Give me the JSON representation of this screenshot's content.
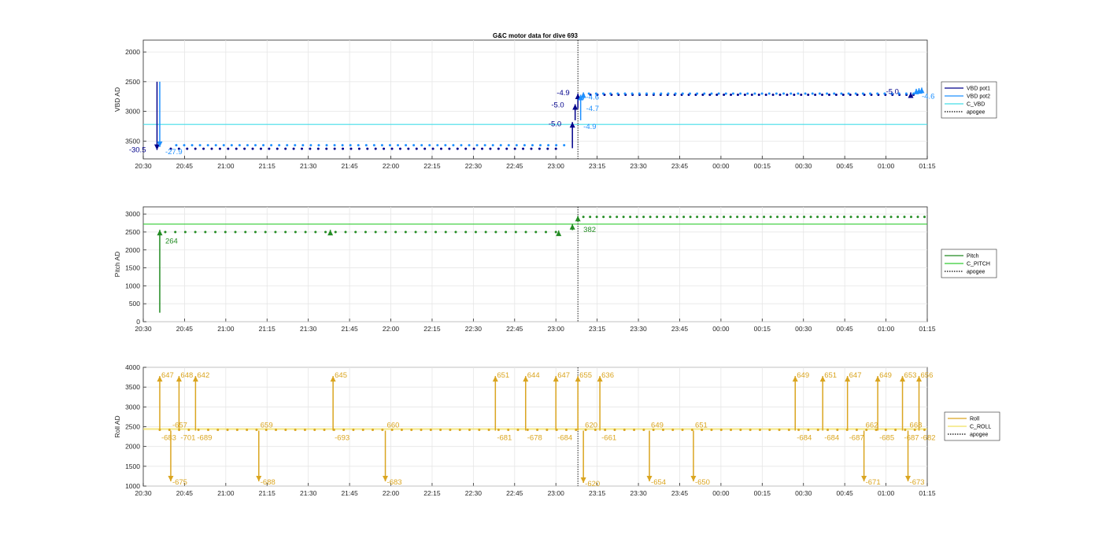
{
  "title": "G&C motor data for dive 693",
  "x_ticks": [
    "20:30",
    "20:45",
    "21:00",
    "21:15",
    "21:30",
    "21:45",
    "22:00",
    "22:15",
    "22:30",
    "22:45",
    "23:00",
    "23:15",
    "23:30",
    "23:45",
    "00:00",
    "00:15",
    "00:30",
    "00:45",
    "01:00",
    "01:15"
  ],
  "colors": {
    "vbd_pot1": "#00008b",
    "vbd_pot2": "#1e90ff",
    "c_vbd": "#44dde8",
    "pitch": "#228b22",
    "c_pitch": "#33cc33",
    "roll": "#daa520",
    "c_roll": "#f0e060",
    "apogee": "#000000",
    "axis": "#262626",
    "grid": "#e6e6e6"
  },
  "chart_data": [
    {
      "type": "line",
      "ylabel": "VBD AD",
      "xlabel": "",
      "x_range": [
        "20:30",
        "01:15"
      ],
      "ylim": [
        3800,
        1800
      ],
      "y_reversed": true,
      "yticks": [
        2000,
        2500,
        3000,
        3500
      ],
      "grid": true,
      "legend": "right",
      "apogee_x": "23:08",
      "series": [
        {
          "name": "VBD pot1",
          "style": "solid",
          "color_key": "vbd_pot1"
        },
        {
          "name": "VBD pot2",
          "style": "solid",
          "color_key": "vbd_pot2"
        },
        {
          "name": "C_VBD",
          "style": "solid",
          "color_key": "c_vbd",
          "y": 3220
        },
        {
          "name": "apogee",
          "style": "dotted",
          "color_key": "apogee"
        }
      ],
      "pot1_dots": {
        "x_start": "20:40",
        "x_end": "23:00",
        "n": 48,
        "y": 3630,
        "tail_start": "23:10",
        "tail_end": "01:10",
        "tail_n": 48,
        "tail_y": 2720
      },
      "pot2_dots": {
        "x_start": "20:42",
        "x_end": "23:03",
        "n": 50,
        "y": 3570,
        "tail_start": "23:12",
        "tail_end": "01:10",
        "tail_n": 46,
        "tail_y": 2700
      },
      "arrows": [
        {
          "x": "20:35",
          "from": 2500,
          "to": 3650,
          "series": "pot1"
        },
        {
          "x": "20:36",
          "from": 2500,
          "to": 3600,
          "series": "pot2"
        },
        {
          "x": "23:06",
          "from": 3620,
          "to": 3180,
          "series": "pot1"
        },
        {
          "x": "23:07",
          "from": 3150,
          "to": 2880,
          "series": "pot1"
        },
        {
          "x": "23:08",
          "from": 2950,
          "to": 2700,
          "series": "pot1"
        },
        {
          "x": "23:09",
          "from": 3150,
          "to": 2720,
          "series": "pot2"
        },
        {
          "x": "23:10",
          "from": 2800,
          "to": 2680,
          "series": "pot2"
        },
        {
          "x": "01:09",
          "from": 2760,
          "to": 2680,
          "series": "pot1"
        },
        {
          "x": "01:11",
          "from": 2700,
          "to": 2620,
          "series": "pot2"
        },
        {
          "x": "01:12",
          "from": 2700,
          "to": 2610,
          "series": "pot2"
        },
        {
          "x": "01:13",
          "from": 2700,
          "to": 2600,
          "series": "pot2"
        }
      ],
      "labels": [
        {
          "text": "-30.5",
          "x": "20:31",
          "y": 3650,
          "series": "pot1",
          "anchor": "end"
        },
        {
          "text": "-27.9",
          "x": "20:38",
          "y": 3680,
          "series": "pot2",
          "anchor": "start"
        },
        {
          "text": "-4.9",
          "x": "23:05",
          "y": 2690,
          "series": "pot1",
          "anchor": "end"
        },
        {
          "text": "-5.0",
          "x": "23:03",
          "y": 2890,
          "series": "pot1",
          "anchor": "end"
        },
        {
          "text": "-5.0",
          "x": "23:02",
          "y": 3210,
          "series": "pot1",
          "anchor": "end"
        },
        {
          "text": "-4.6",
          "x": "23:11",
          "y": 2760,
          "series": "pot2",
          "anchor": "start"
        },
        {
          "text": "-4.7",
          "x": "23:11",
          "y": 2950,
          "series": "pot2",
          "anchor": "start"
        },
        {
          "text": "-4.9",
          "x": "23:10",
          "y": 3260,
          "series": "pot2",
          "anchor": "start"
        },
        {
          "text": "-5.0",
          "x": "01:00",
          "y": 2670,
          "series": "pot1",
          "anchor": "start"
        },
        {
          "text": "-4.6",
          "x": "01:13",
          "y": 2750,
          "series": "pot2",
          "anchor": "start"
        }
      ]
    },
    {
      "type": "line",
      "ylabel": "Pitch AD",
      "xlabel": "",
      "x_range": [
        "20:30",
        "01:15"
      ],
      "ylim": [
        0,
        3200
      ],
      "yticks": [
        0,
        500,
        1000,
        1500,
        2000,
        2500,
        3000
      ],
      "grid": true,
      "legend": "right",
      "apogee_x": "23:08",
      "series": [
        {
          "name": "Pitch",
          "style": "solid",
          "color_key": "pitch"
        },
        {
          "name": "C_PITCH",
          "style": "solid",
          "color_key": "c_pitch",
          "y": 2720
        },
        {
          "name": "apogee",
          "style": "dotted",
          "color_key": "apogee"
        }
      ],
      "dots": {
        "x_start": "20:38",
        "x_end": "23:00",
        "n": 40,
        "y": 2500,
        "tail_start": "23:10",
        "tail_end": "01:14",
        "tail_n": 52,
        "tail_y": 2920
      },
      "arrows": [
        {
          "x": "20:36",
          "from": 250,
          "to": 2560
        },
        {
          "x": "21:38",
          "from": 2480,
          "to": 2560
        },
        {
          "x": "23:01",
          "from": 2460,
          "to": 2540
        },
        {
          "x": "23:06",
          "from": 2550,
          "to": 2720
        },
        {
          "x": "23:08",
          "from": 2800,
          "to": 2950
        }
      ],
      "labels": [
        {
          "text": "264",
          "x": "20:38",
          "y": 2250,
          "anchor": "start"
        },
        {
          "text": "382",
          "x": "23:10",
          "y": 2560,
          "anchor": "start"
        }
      ]
    },
    {
      "type": "line",
      "ylabel": "Roll AD",
      "xlabel": "",
      "x_range": [
        "20:30",
        "01:15"
      ],
      "ylim": [
        1000,
        4000
      ],
      "yticks": [
        1000,
        1500,
        2000,
        2500,
        3000,
        3500,
        4000
      ],
      "grid": true,
      "legend": "right",
      "apogee_x": "23:08",
      "series": [
        {
          "name": "Roll",
          "style": "solid",
          "color_key": "roll"
        },
        {
          "name": "C_ROLL",
          "style": "solid",
          "color_key": "c_roll",
          "y": 2440
        },
        {
          "name": "apogee",
          "style": "dotted",
          "color_key": "apogee"
        }
      ],
      "dots": {
        "x_start": "20:36",
        "x_end": "01:14",
        "n": 80,
        "y": 2420
      },
      "arrows": [
        {
          "x": "20:36",
          "from": 2400,
          "to": 3780,
          "up": "647",
          "down": "-683"
        },
        {
          "x": "20:40",
          "from": 2400,
          "to": 1120,
          "up": "-657",
          "down": "-675"
        },
        {
          "x": "20:43",
          "from": 2400,
          "to": 3780,
          "up": "648",
          "down": "-701"
        },
        {
          "x": "20:49",
          "from": 2400,
          "to": 3780,
          "up": "642",
          "down": "-689"
        },
        {
          "x": "21:12",
          "from": 2400,
          "to": 1120,
          "up": "659",
          "down": "-688"
        },
        {
          "x": "21:39",
          "from": 2400,
          "to": 3780,
          "up": "645",
          "down": "-693"
        },
        {
          "x": "21:58",
          "from": 2400,
          "to": 1120,
          "up": "660",
          "down": "-683"
        },
        {
          "x": "22:38",
          "from": 2400,
          "to": 3780,
          "up": "651",
          "down": "-681"
        },
        {
          "x": "22:49",
          "from": 2400,
          "to": 3780,
          "up": "644",
          "down": "-678"
        },
        {
          "x": "23:00",
          "from": 2400,
          "to": 3780,
          "up": "647",
          "down": "-684"
        },
        {
          "x": "23:08",
          "from": 2400,
          "to": 3780,
          "up": "655",
          "down": ""
        },
        {
          "x": "23:10",
          "from": 2400,
          "to": 1080,
          "up": "620",
          "down": "-620"
        },
        {
          "x": "23:16",
          "from": 2400,
          "to": 3780,
          "up": "636",
          "down": "-661"
        },
        {
          "x": "23:34",
          "from": 2400,
          "to": 1120,
          "up": "649",
          "down": "-654"
        },
        {
          "x": "23:50",
          "from": 2400,
          "to": 1120,
          "up": "651",
          "down": "-650"
        },
        {
          "x": "00:27",
          "from": 2400,
          "to": 3780,
          "up": "649",
          "down": "-684"
        },
        {
          "x": "00:37",
          "from": 2400,
          "to": 3780,
          "up": "651",
          "down": "-684"
        },
        {
          "x": "00:46",
          "from": 2400,
          "to": 3780,
          "up": "647",
          "down": "-687"
        },
        {
          "x": "00:52",
          "from": 2400,
          "to": 1120,
          "up": "662",
          "down": "-671"
        },
        {
          "x": "00:57",
          "from": 2400,
          "to": 3780,
          "up": "649",
          "down": "-685"
        },
        {
          "x": "01:06",
          "from": 2400,
          "to": 3780,
          "up": "653",
          "down": "-687"
        },
        {
          "x": "01:08",
          "from": 2400,
          "to": 1120,
          "up": "668",
          "down": "-673"
        },
        {
          "x": "01:12",
          "from": 2400,
          "to": 3780,
          "up": "656",
          "down": "-682"
        }
      ]
    }
  ]
}
